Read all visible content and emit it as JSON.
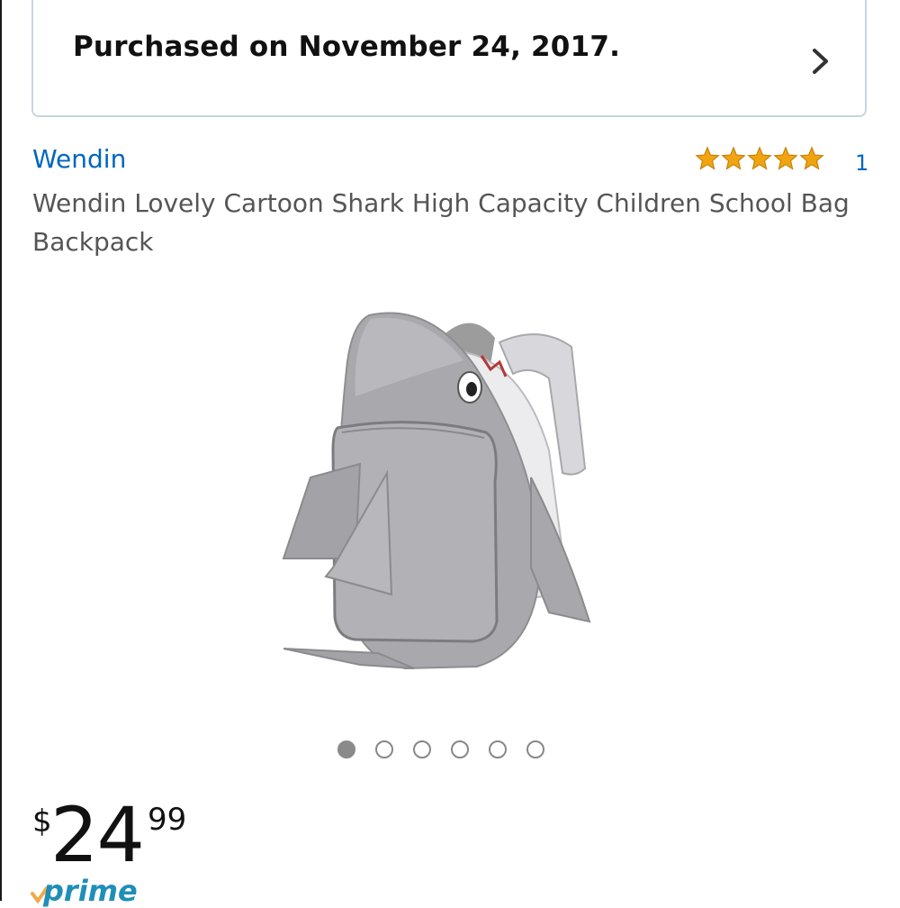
{
  "purchase": {
    "text": "Purchased on November 24, 2017.",
    "icon": "chevron-right-icon"
  },
  "product": {
    "brand": "Wendin",
    "rating": {
      "stars": 5,
      "max": 5,
      "count": "1",
      "color": "#f0a40f"
    },
    "title": "Wendin Lovely Cartoon Shark High Capacity Children School Bag Backpack",
    "image_alt": "shark-backpack-image",
    "images": {
      "count": 6,
      "active_index": 0
    },
    "price": {
      "symbol": "$",
      "whole": "24",
      "fraction": "99"
    },
    "prime": {
      "label": "prime",
      "color": "#1f8fb8",
      "check_color": "#f3a847"
    }
  },
  "colors": {
    "link": "#0066c0",
    "banner_border": "#c6d6df",
    "title_gray": "#555555"
  }
}
